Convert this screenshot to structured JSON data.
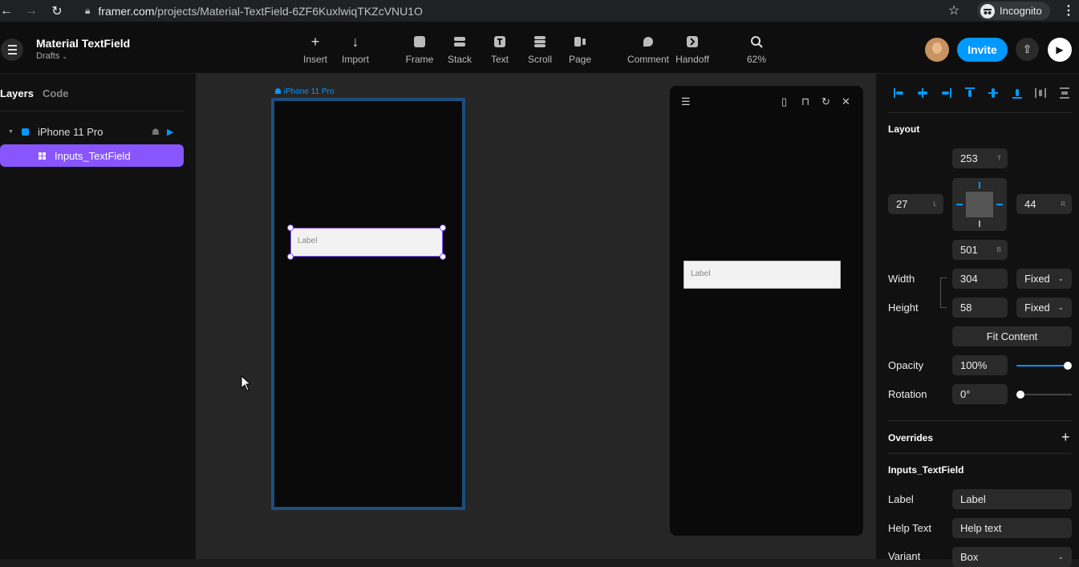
{
  "browser": {
    "url_host": "framer.com",
    "url_path": "/projects/Material-TextField-6ZF6KuxlwiqTKZcVNU1O",
    "incognito_label": "Incognito"
  },
  "toolbar": {
    "project_title": "Material TextField",
    "project_location": "Drafts",
    "tools": {
      "insert": "Insert",
      "import": "Import",
      "frame": "Frame",
      "stack": "Stack",
      "text": "Text",
      "scroll": "Scroll",
      "page": "Page",
      "comment": "Comment",
      "handoff": "Handoff",
      "zoom": "62%"
    },
    "invite_label": "Invite"
  },
  "left_panel": {
    "tabs": {
      "layers": "Layers",
      "code": "Code"
    },
    "layers": [
      {
        "name": "iPhone 11 Pro"
      },
      {
        "name": "Inputs_TextField"
      }
    ]
  },
  "canvas": {
    "frame_label": "iPhone 11 Pro",
    "textfield_label": "Label",
    "preview_textfield_label": "Label"
  },
  "right_panel": {
    "layout": {
      "title": "Layout",
      "top": "253",
      "top_suffix": "T",
      "left": "27",
      "left_suffix": "L",
      "right": "44",
      "right_suffix": "R",
      "bottom": "501",
      "bottom_suffix": "B",
      "width_label": "Width",
      "width": "304",
      "width_mode": "Fixed",
      "height_label": "Height",
      "height": "58",
      "height_mode": "Fixed",
      "fit_content": "Fit Content",
      "opacity_label": "Opacity",
      "opacity": "100%",
      "rotation_label": "Rotation",
      "rotation": "0°"
    },
    "overrides": {
      "title": "Overrides",
      "component_name": "Inputs_TextField",
      "fields": [
        {
          "label": "Label",
          "value": "Label"
        },
        {
          "label": "Help Text",
          "value": "Help text"
        },
        {
          "label": "Variant",
          "value": "Box"
        }
      ]
    }
  }
}
